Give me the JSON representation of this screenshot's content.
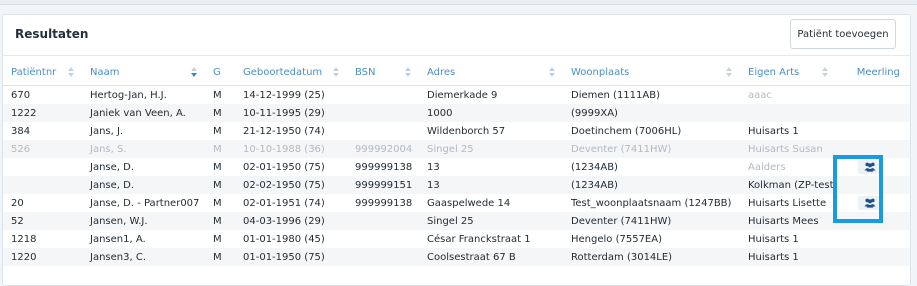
{
  "results": {
    "title": "Resultaten",
    "add_button": "Patiënt toevoegen",
    "columns": [
      {
        "label": "Patiëntnr",
        "sortable": true,
        "active": false
      },
      {
        "label": "Naam",
        "sortable": true,
        "active": true
      },
      {
        "label": "G",
        "sortable": false,
        "active": false
      },
      {
        "label": "Geboortedatum",
        "sortable": true,
        "active": false
      },
      {
        "label": "BSN",
        "sortable": true,
        "active": false
      },
      {
        "label": "Adres",
        "sortable": true,
        "active": false
      },
      {
        "label": "Woonplaats",
        "sortable": true,
        "active": false
      },
      {
        "label": "Eigen Arts",
        "sortable": true,
        "active": false
      },
      {
        "label": "Meerling",
        "sortable": false,
        "active": false
      }
    ],
    "rows": [
      {
        "nr": "670",
        "naam": "Hertog-Jan, H.J.",
        "g": "M",
        "geb": "14-12-1999 (25)",
        "bsn": "",
        "adres": "Diemerkade 9",
        "woonplaats": "Diemen (1111AB)",
        "arts": "aaac",
        "arts_muted": true,
        "muted": false,
        "meerling": false
      },
      {
        "nr": "1222",
        "naam": "Janiek van Veen, A.",
        "g": "M",
        "geb": "10-11-1995 (29)",
        "bsn": "",
        "adres": "1000",
        "woonplaats": "(9999XA)",
        "arts": "",
        "arts_muted": false,
        "muted": false,
        "meerling": false
      },
      {
        "nr": "384",
        "naam": "Jans, J.",
        "g": "M",
        "geb": "21-12-1950 (74)",
        "bsn": "",
        "adres": "Wildenborch 57",
        "woonplaats": "Doetinchem (7006HL)",
        "arts": "Huisarts 1",
        "arts_muted": false,
        "muted": false,
        "meerling": false
      },
      {
        "nr": "526",
        "naam": "Jans, S.",
        "g": "M",
        "geb": "10-10-1988 (36)",
        "bsn": "999992004",
        "adres": "Singel 25",
        "woonplaats": "Deventer (7411HW)",
        "arts": "Huisarts Susan",
        "arts_muted": false,
        "muted": true,
        "meerling": false
      },
      {
        "nr": "",
        "naam": "Janse, D.",
        "g": "M",
        "geb": "02-01-1950 (75)",
        "bsn": "999999138",
        "adres": "13",
        "woonplaats": "(1234AB)",
        "arts": "Aalders",
        "arts_muted": true,
        "muted": false,
        "meerling": true
      },
      {
        "nr": "",
        "naam": "Janse, D.",
        "g": "M",
        "geb": "02-02-1950 (75)",
        "bsn": "999999151",
        "adres": "13",
        "woonplaats": "(1234AB)",
        "arts": "Kolkman (ZP-test)",
        "arts_muted": false,
        "muted": false,
        "meerling": false
      },
      {
        "nr": "20",
        "naam": "Janse, D. - Partner007",
        "g": "M",
        "geb": "02-01-1951 (74)",
        "bsn": "999999138",
        "adres": "Gaaspelwede 14",
        "woonplaats": "Test_woonplaatsnaam (1247BB)",
        "arts": "Huisarts Lisette",
        "arts_muted": false,
        "muted": false,
        "meerling": true
      },
      {
        "nr": "52",
        "naam": "Jansen, W.J.",
        "g": "M",
        "geb": "04-03-1996 (29)",
        "bsn": "",
        "adres": "Singel 25",
        "woonplaats": "Deventer (7411HW)",
        "arts": "Huisarts Mees",
        "arts_muted": false,
        "muted": false,
        "meerling": false
      },
      {
        "nr": "1218",
        "naam": "Jansen1, A.",
        "g": "M",
        "geb": "01-01-1980 (45)",
        "bsn": "",
        "adres": "César Franckstraat 1",
        "woonplaats": "Hengelo (7557EA)",
        "arts": "Huisarts 1",
        "arts_muted": false,
        "muted": false,
        "meerling": false
      },
      {
        "nr": "1220",
        "naam": "Jansen3, C.",
        "g": "M",
        "geb": "01-01-1950 (75)",
        "bsn": "",
        "adres": "Coolsestraat 67 B",
        "woonplaats": "Rotterdam (3014LE)",
        "arts": "Huisarts 1",
        "arts_muted": false,
        "muted": false,
        "meerling": false
      }
    ]
  },
  "icons": {
    "meerling": "users-icon",
    "sort": "sort-icon"
  },
  "colors": {
    "header_text": "#4a8fc7",
    "highlight": "#1a9ae0",
    "meerling_icon": "#1d4f8a"
  }
}
